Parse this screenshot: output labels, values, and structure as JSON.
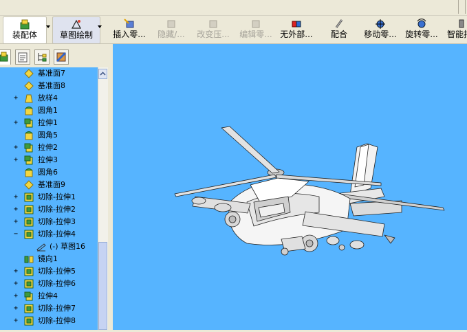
{
  "toolbar": {
    "buttons": [
      {
        "label": "装配体"
      },
      {
        "label": "草图绘制"
      },
      {
        "label": "插入零..."
      },
      {
        "label": "隐藏/..."
      },
      {
        "label": "改变压..."
      },
      {
        "label": "编辑零..."
      },
      {
        "label": "无外部..."
      },
      {
        "label": "配合"
      },
      {
        "label": "移动零..."
      },
      {
        "label": "旋转零..."
      },
      {
        "label": "智能扣"
      }
    ]
  },
  "tree": {
    "items": [
      {
        "label": "基准面7",
        "icon": "plane-icon"
      },
      {
        "label": "基准面8",
        "icon": "plane-icon"
      },
      {
        "label": "放样4",
        "icon": "loft-icon"
      },
      {
        "label": "圆角1",
        "icon": "fillet-icon"
      },
      {
        "label": "拉伸1",
        "icon": "extrude-icon"
      },
      {
        "label": "圆角5",
        "icon": "fillet-icon"
      },
      {
        "label": "拉伸2",
        "icon": "extrude-icon"
      },
      {
        "label": "拉伸3",
        "icon": "extrude-icon"
      },
      {
        "label": "圆角6",
        "icon": "fillet-icon"
      },
      {
        "label": "基准面9",
        "icon": "plane-icon"
      },
      {
        "label": "切除-拉伸1",
        "icon": "cut-extrude-icon"
      },
      {
        "label": "切除-拉伸2",
        "icon": "cut-extrude-icon"
      },
      {
        "label": "切除-拉伸3",
        "icon": "cut-extrude-icon"
      },
      {
        "label": "切除-拉伸4",
        "icon": "cut-extrude-icon"
      },
      {
        "label": "(-) 草图16",
        "icon": "sketch-icon"
      },
      {
        "label": "镜向1",
        "icon": "mirror-icon"
      },
      {
        "label": "切除-拉伸5",
        "icon": "cut-extrude-icon"
      },
      {
        "label": "切除-拉伸6",
        "icon": "cut-extrude-icon"
      },
      {
        "label": "拉伸4",
        "icon": "extrude-icon"
      },
      {
        "label": "切除-拉伸7",
        "icon": "cut-extrude-icon"
      },
      {
        "label": "切除-拉伸8",
        "icon": "cut-extrude-icon"
      }
    ]
  },
  "viewport": {
    "background_color": "#56b4ff",
    "model": "helicopter-model"
  },
  "colors": {
    "tree_background": "#56b4ff",
    "viewport_background": "#56b4ff",
    "chrome": "#ece9d8"
  }
}
